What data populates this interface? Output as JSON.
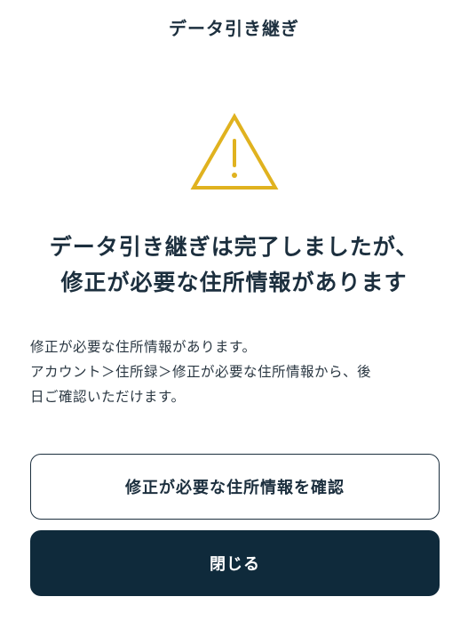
{
  "header": {
    "title": "データ引き継ぎ"
  },
  "alert": {
    "icon": "warning-icon",
    "icon_color": "#e0b21f",
    "heading_line1": "データ引き継ぎは完了しましたが、",
    "heading_line2": "修正が必要な住所情報があります",
    "message_line1": "修正が必要な住所情報があります。",
    "message_line2": "アカウント＞住所録＞修正が必要な住所情報から、後",
    "message_line3": "日ご確認いただけます。"
  },
  "actions": {
    "confirm_label": "修正が必要な住所情報を確認",
    "close_label": "閉じる"
  },
  "colors": {
    "text": "#1c2f3e",
    "primary": "#0f2a3b",
    "warning": "#e0b21f"
  }
}
